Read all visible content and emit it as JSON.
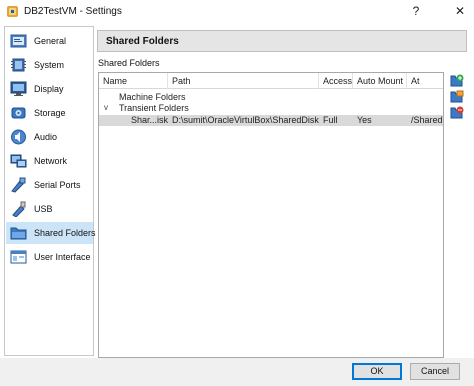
{
  "window": {
    "title": "DB2TestVM - Settings",
    "help_glyph": "?",
    "close_glyph": "✕"
  },
  "sidebar": {
    "items": [
      {
        "label": "General",
        "icon": "general-icon"
      },
      {
        "label": "System",
        "icon": "system-chip-icon"
      },
      {
        "label": "Display",
        "icon": "display-monitor-icon"
      },
      {
        "label": "Storage",
        "icon": "storage-disk-icon"
      },
      {
        "label": "Audio",
        "icon": "audio-speaker-icon"
      },
      {
        "label": "Network",
        "icon": "network-icon"
      },
      {
        "label": "Serial Ports",
        "icon": "serial-port-icon"
      },
      {
        "label": "USB",
        "icon": "usb-icon"
      },
      {
        "label": "Shared Folders",
        "icon": "shared-folder-icon",
        "selected": true
      },
      {
        "label": "User Interface",
        "icon": "user-interface-icon"
      }
    ]
  },
  "page": {
    "title": "Shared Folders",
    "group_label": "Shared Folders"
  },
  "table": {
    "columns": [
      "Name",
      "Path",
      "Access",
      "Auto Mount",
      "At"
    ],
    "groups": [
      {
        "label": "Machine Folders"
      },
      {
        "label": "Transient Folders",
        "expanded_glyph": "v"
      }
    ],
    "rows": [
      {
        "name": "Shar...isk",
        "path": "D:\\sumit\\OracleVirtulBox\\SharedDisk",
        "access": "Full",
        "auto_mount": "Yes",
        "at": "/Shared"
      }
    ]
  },
  "tools": [
    {
      "icon": "add-shared-folder-icon"
    },
    {
      "icon": "edit-shared-folder-icon"
    },
    {
      "icon": "remove-shared-folder-icon"
    }
  ],
  "buttons": {
    "ok": "OK",
    "cancel": "Cancel"
  },
  "colors": {
    "selection": "#cce4f7",
    "row_selected": "#d9d9d9",
    "header_bg": "#e5e5e5",
    "default_button_border": "#0078d7"
  }
}
